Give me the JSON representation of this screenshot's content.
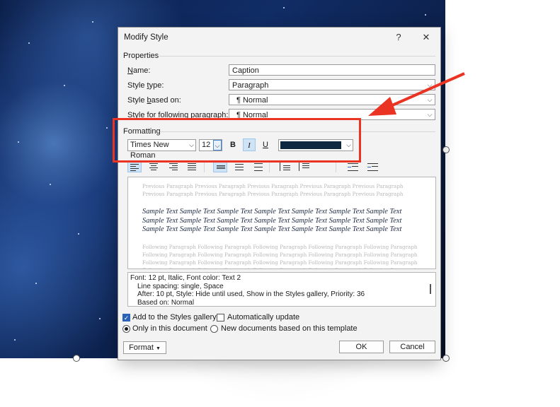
{
  "dialog": {
    "title": "Modify Style",
    "help_glyph": "?",
    "close_glyph": "✕"
  },
  "properties": {
    "heading": "Properties",
    "name_label": "ame:",
    "name_label_key": "N",
    "name_value": "Caption",
    "style_type_label_pre": "Style ",
    "style_type_label_key": "t",
    "style_type_label_post": "ype:",
    "style_type_value": "Paragraph",
    "based_on_label_pre": "Style ",
    "based_on_label_key": "b",
    "based_on_label_post": "ased on:",
    "based_on_value": "¶  Normal",
    "following_label_pre": "Style for following paragraph:",
    "following_value": "¶  Normal"
  },
  "formatting": {
    "heading": "Formatting",
    "font": "Times New Roman",
    "size": "12",
    "bold": "B",
    "italic": "I",
    "underline": "U",
    "color_hex": "#0e2841"
  },
  "preview": {
    "previous": "Previous Paragraph Previous Paragraph Previous Paragraph Previous Paragraph Previous Paragraph Previous Paragraph Previous Paragraph Previous Paragraph Previous Paragraph Previous Paragraph",
    "sample": "Sample Text Sample Text Sample Text Sample Text Sample Text Sample Text Sample Text Sample Text Sample Text Sample Text Sample Text Sample Text Sample Text Sample Text Sample Text Sample Text Sample Text Sample Text Sample Text Sample Text Sample Text",
    "following": "Following Paragraph Following Paragraph Following Paragraph Following Paragraph Following Paragraph Following Paragraph Following Paragraph Following Paragraph Following Paragraph Following Paragraph Following Paragraph Following Paragraph Following Paragraph Following Paragraph Following Paragraph Following Paragraph Following Paragraph Following Paragraph Following Paragraph Following Paragraph Following Paragraph Following Paragraph Following Paragraph Following Paragraph Following Paragraph"
  },
  "description": {
    "line1": "Font: 12 pt, Italic, Font color: Text 2",
    "line2": "Line spacing:  single, Space",
    "line3": "After:  10 pt, Style: Hide until used, Show in the Styles gallery, Priority: 36",
    "line4": "Based on: Normal"
  },
  "options": {
    "add_to_gallery": "Add to the Styles gallery",
    "auto_update": "Automatically update",
    "only_this_doc": "Only in this document",
    "new_docs": "New documents based on this template"
  },
  "buttons": {
    "format": "Format",
    "ok": "OK",
    "cancel": "Cancel"
  },
  "colors": {
    "highlight_red": "#ea3323",
    "checkbox_blue": "#2b63b8",
    "active_button": "#cfe3f7"
  }
}
